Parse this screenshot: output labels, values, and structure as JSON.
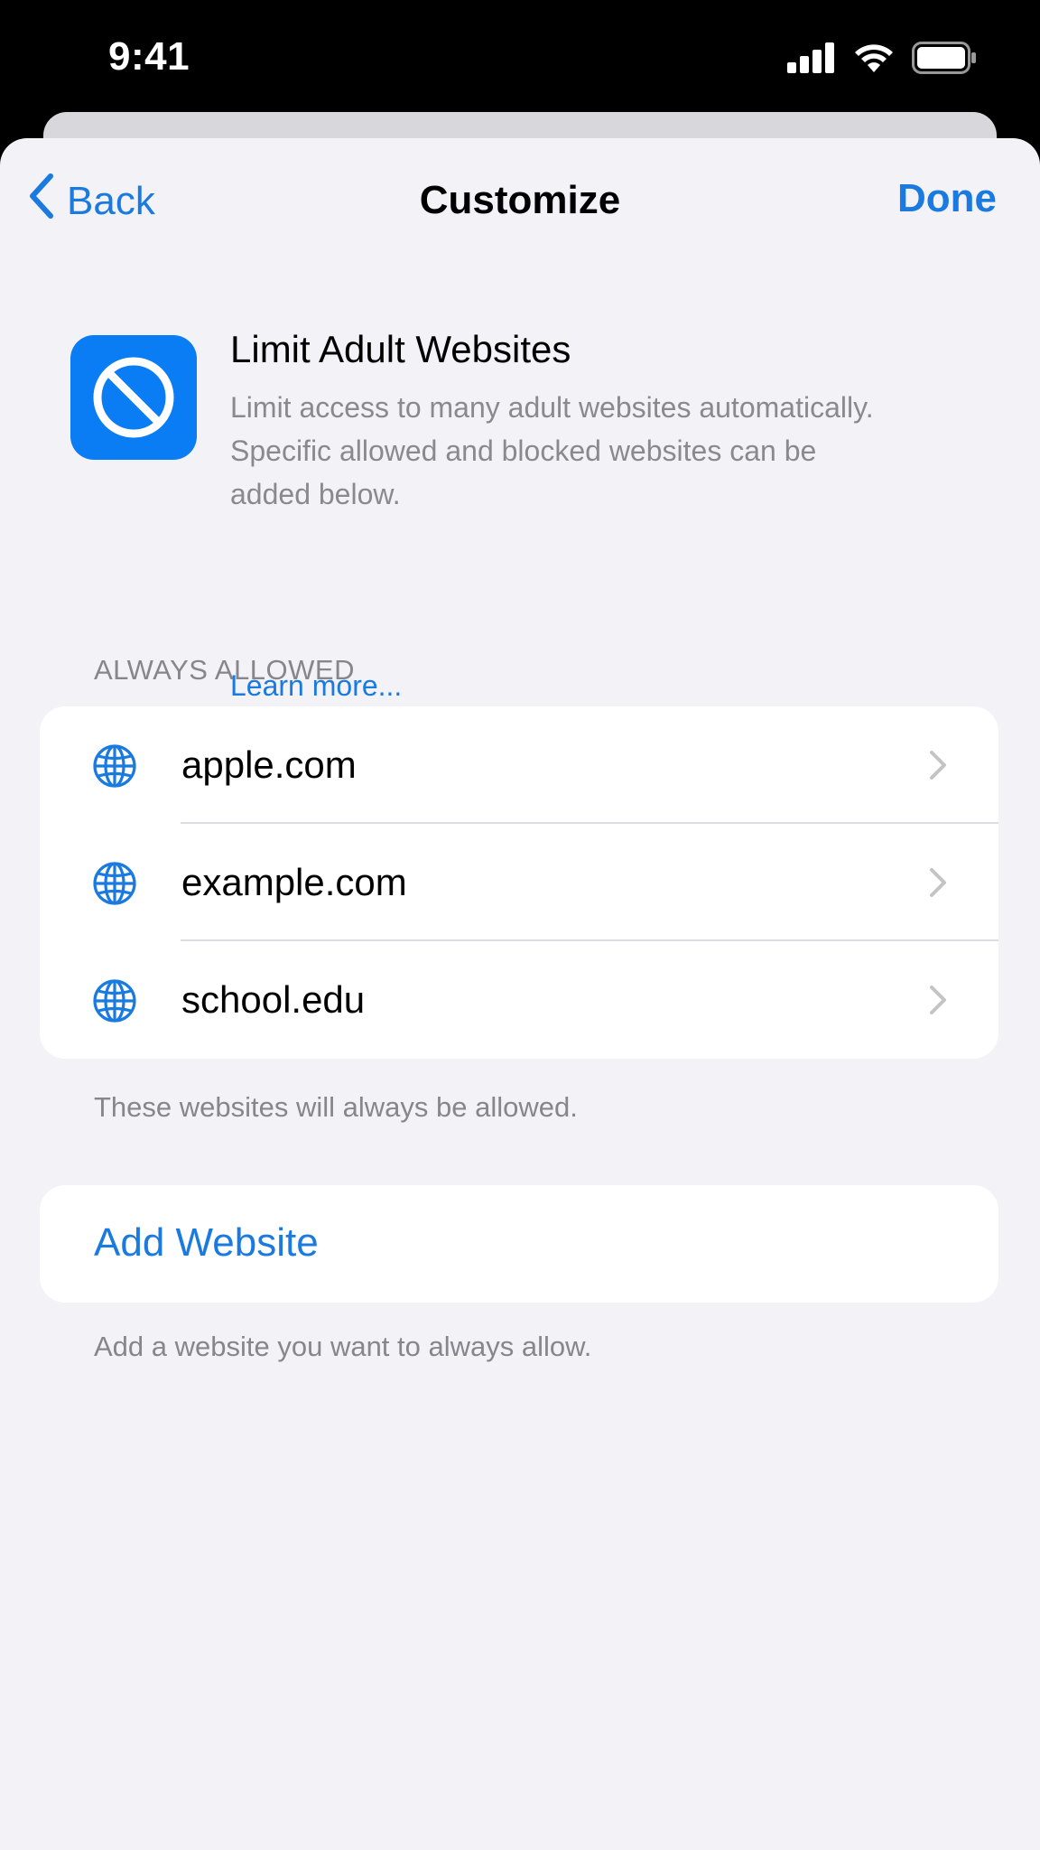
{
  "status_bar": {
    "time": "9:41",
    "icons": [
      "cellular-signal-icon",
      "wifi-icon",
      "battery-icon"
    ]
  },
  "nav": {
    "back_label": "Back",
    "title": "Customize",
    "done_label": "Done"
  },
  "feature": {
    "icon": "blocked-circle-icon",
    "title": "Limit Adult Websites",
    "description": "Limit access to many adult websites automatically. Specific allowed and blocked websites can be added below.",
    "link": "Learn more..."
  },
  "always_allowed": {
    "header": "ALWAYS ALLOWED",
    "items": [
      {
        "site": "apple.com",
        "icon": "globe-icon"
      },
      {
        "site": "example.com",
        "icon": "globe-icon"
      },
      {
        "site": "school.edu",
        "icon": "globe-icon"
      }
    ],
    "footer": "These websites will always be allowed."
  },
  "add_website": {
    "label": "Add Website",
    "footer": "Add a website you want to always allow."
  },
  "colors": {
    "accent": "#1a7ae0",
    "icon_blue": "#0a7df5",
    "background": "#f2f2f7",
    "secondary_text": "#86868b"
  }
}
